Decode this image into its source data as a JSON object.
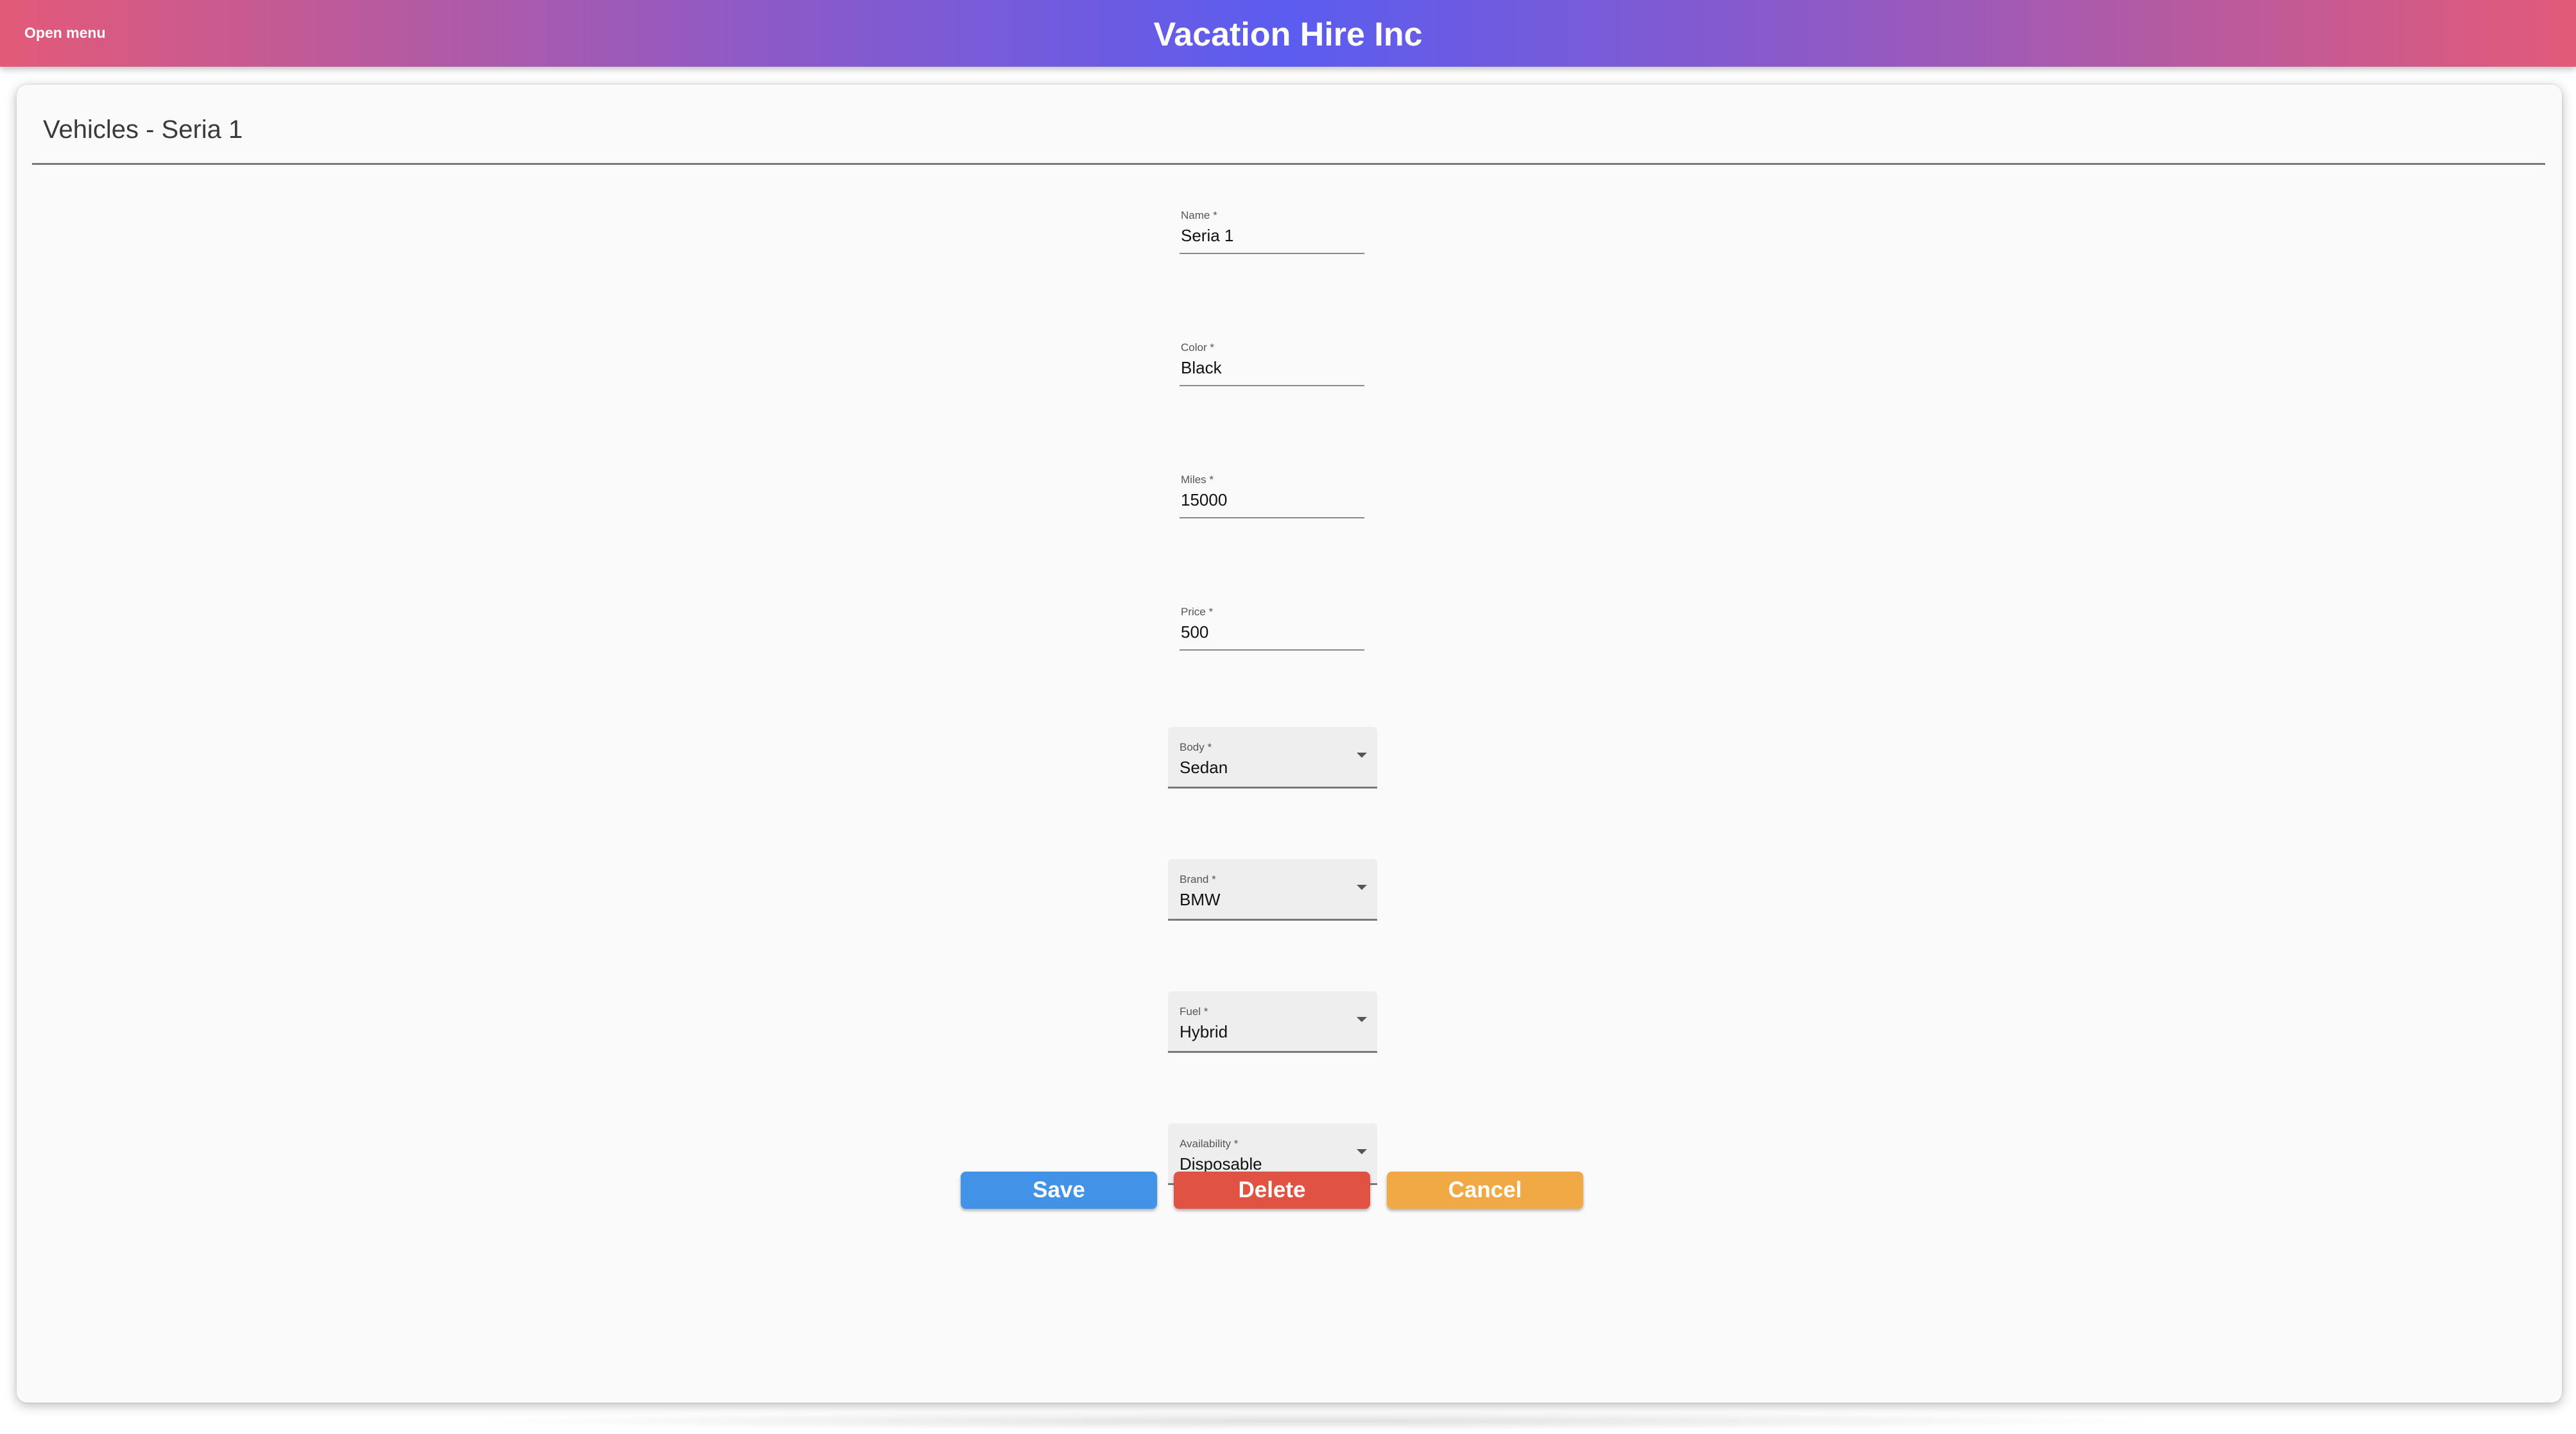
{
  "header": {
    "menu_label": "Open menu",
    "app_title": "Vacation Hire Inc"
  },
  "page": {
    "title": "Vehicles - Seria 1"
  },
  "form": {
    "name": {
      "label": "Name *",
      "value": "Seria 1"
    },
    "color": {
      "label": "Color *",
      "value": "Black"
    },
    "miles": {
      "label": "Miles *",
      "value": "15000"
    },
    "price": {
      "label": "Price *",
      "value": "500"
    },
    "body": {
      "label": "Body *",
      "value": "Sedan"
    },
    "brand": {
      "label": "Brand *",
      "value": "BMW"
    },
    "fuel": {
      "label": "Fuel *",
      "value": "Hybrid"
    },
    "availability": {
      "label": "Availability *",
      "value": "Disposable"
    }
  },
  "actions": {
    "save_label": "Save",
    "delete_label": "Delete",
    "cancel_label": "Cancel"
  },
  "colors": {
    "header_gradient_edge": "#e35a78",
    "header_gradient_center": "#5b5cf0",
    "save": "#4293e8",
    "delete": "#e05241",
    "cancel": "#f1a945"
  },
  "icons": {
    "select_caret": "caret-down-icon"
  }
}
